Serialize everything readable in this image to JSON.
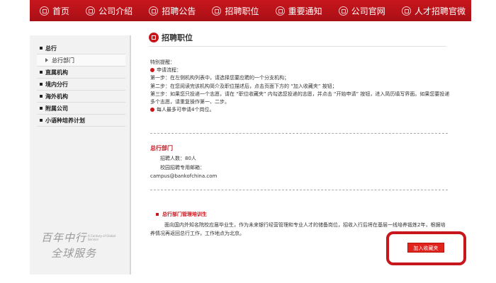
{
  "nav": {
    "items": [
      "首页",
      "公司介绍",
      "招聘公告",
      "招聘职位",
      "重要通知",
      "公司官网",
      "人才招聘官微"
    ]
  },
  "sidebar": {
    "items": [
      {
        "label": "总行",
        "type": "main"
      },
      {
        "label": "总行部门",
        "type": "sub"
      },
      {
        "label": "直属机构",
        "type": "main"
      },
      {
        "label": "境内分行",
        "type": "main"
      },
      {
        "label": "海外机构",
        "type": "main"
      },
      {
        "label": "附属公司",
        "type": "main"
      },
      {
        "label": "小语种培养计划",
        "type": "main"
      }
    ],
    "slogan_line1": "百年中行",
    "slogan_line2": "全球服务",
    "slogan_en": "A Century of Global Service"
  },
  "main": {
    "title": "招聘职位",
    "notes": {
      "heading": "特别提醒：",
      "flow_label": "申请流程：",
      "step1": "第一步：在左侧机构列表中，请选择您要应聘的一个分支机构；",
      "step2": "第二步：在您阅读完该机构简介及职位描述后，点击页面下方的 “加入收藏夹” 按钮；",
      "step3": "第三步：如果您只投递一个志愿，请在 “职位收藏夹” 内勾选您投递的志愿，并点击 “开始申请” 按钮，进入简历填写界面。如果您要投递多个志愿，请重复操作第一、二步。",
      "limit": "每人最多可申请4个岗位。"
    },
    "dept": {
      "title": "总行部门",
      "headcount": "招聘人数：80人",
      "email_label": "校园招聘专用邮箱：",
      "email": "campus@bankofchina.com"
    },
    "program": {
      "title": "总行部门管理培训生",
      "description": "面向国内外知名院校应届毕业生，作为未来银行经营管理和专业人才的储备岗位，招收入行后将在基层一线培养锻炼2年，根据培养情况再返回总行工作，工作地点为北京。"
    },
    "favorite_button": "加入收藏夹"
  }
}
